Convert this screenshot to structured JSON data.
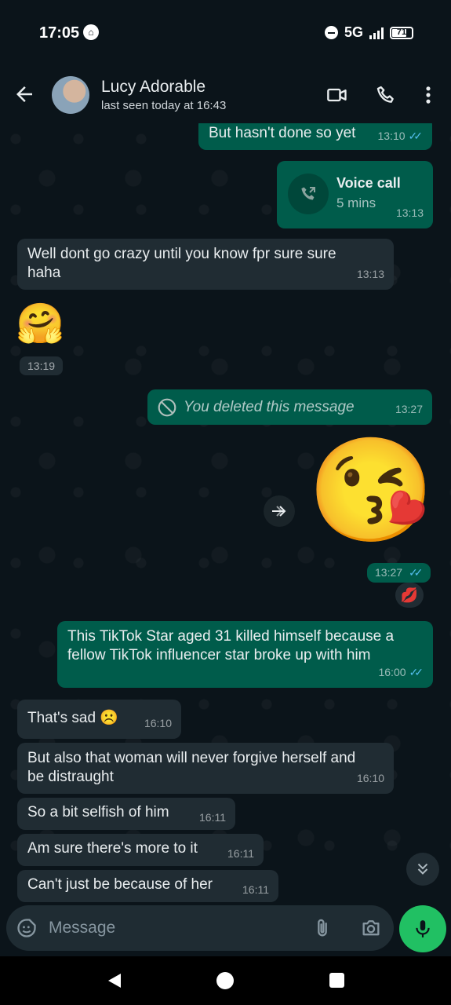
{
  "status": {
    "time": "17:05",
    "network": "5G",
    "battery": "71"
  },
  "header": {
    "contact_name": "Lucy Adorable",
    "last_seen": "last seen today at 16:43"
  },
  "messages": {
    "m1": {
      "text": "But hasn't done so yet",
      "time": "13:10"
    },
    "call": {
      "title": "Voice call",
      "duration": "5 mins",
      "time": "13:13"
    },
    "m2": {
      "text": "Well dont go crazy until you know fpr sure sure haha",
      "time": "13:13"
    },
    "m3": {
      "emoji": "🤗",
      "time": "13:19"
    },
    "m4": {
      "text": "You deleted this message",
      "time": "13:27"
    },
    "m5": {
      "emoji": "😘",
      "time": "13:27",
      "reaction": "💋"
    },
    "m6": {
      "text": "This TikTok Star aged 31 killed himself because a fellow TikTok influencer star broke up with him",
      "time": "16:00"
    },
    "m7": {
      "text": "That's sad ☹️",
      "time": "16:10"
    },
    "m8": {
      "text": "But also that woman will never forgive herself and be distraught",
      "time": "16:10"
    },
    "m9": {
      "text": "So a bit selfish of him",
      "time": "16:11"
    },
    "m10": {
      "text": "Am sure there's more to it",
      "time": "16:11"
    },
    "m11": {
      "text": "Can't just be because of her",
      "time": "16:11"
    }
  },
  "composer": {
    "placeholder": "Message"
  },
  "colors": {
    "accent": "#21c063",
    "outgoing": "#005c4b",
    "incoming": "#202c33",
    "read_ticks": "#53bdeb"
  }
}
